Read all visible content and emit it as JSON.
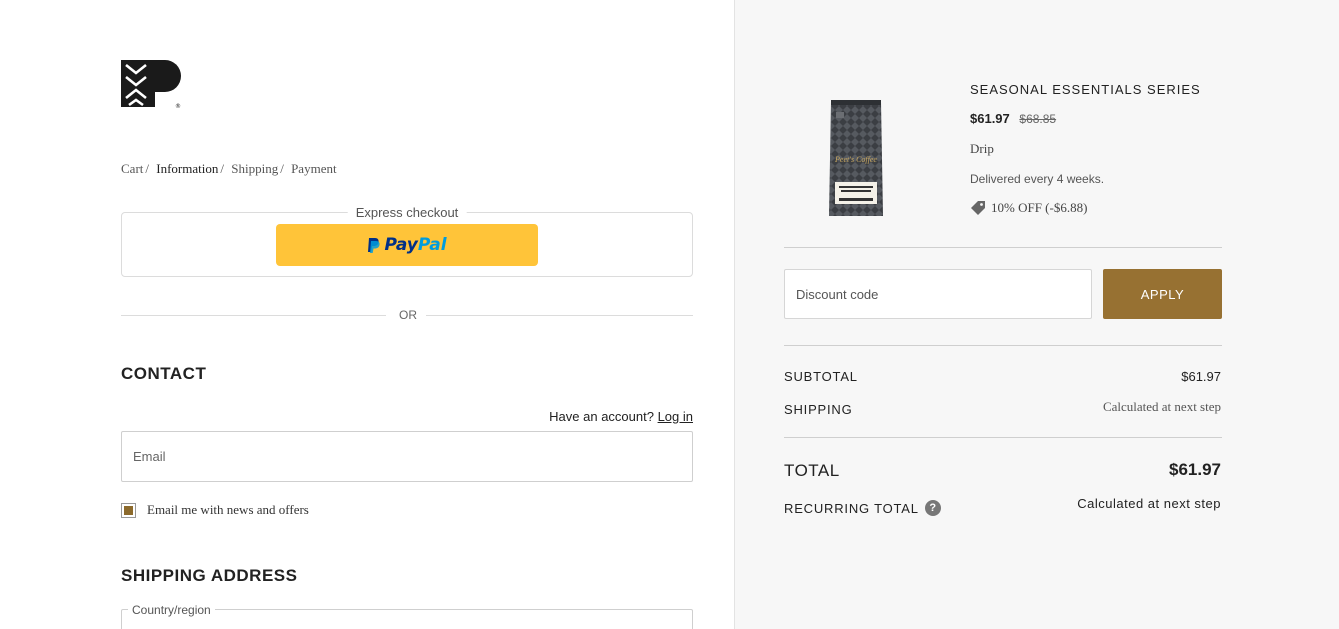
{
  "logo": {
    "icon": "peets-p-logo-icon"
  },
  "breadcrumb": {
    "items": [
      "Cart",
      "Information",
      "Shipping",
      "Payment"
    ],
    "separator": "/"
  },
  "express": {
    "label": "Express checkout",
    "paypal_pay": "Pay",
    "paypal_pal": "Pal",
    "paypal_color": "#ffc439"
  },
  "divider_or": "OR",
  "contact": {
    "heading": "CONTACT",
    "account_prompt": "Have an account?",
    "login_link": "Log in",
    "email_placeholder": "Email",
    "news_label": "Email me with news and offers",
    "news_checked": true
  },
  "shipping": {
    "heading": "SHIPPING ADDRESS",
    "country_label": "Country/region"
  },
  "product": {
    "title": "SEASONAL ESSENTIALS SERIES",
    "price": "$61.97",
    "original_price": "$68.85",
    "variant": "Drip",
    "delivery": "Delivered every 4 weeks.",
    "discount": "10% OFF (-$6.88)",
    "image_icon": "coffee-bag-icon"
  },
  "discount_code": {
    "placeholder": "Discount code",
    "apply_label": "APPLY",
    "button_color": "#977132"
  },
  "summary": {
    "subtotal_label": "SUBTOTAL",
    "subtotal_value": "$61.97",
    "shipping_label": "SHIPPING",
    "shipping_value": "Calculated at next step",
    "total_label": "TOTAL",
    "total_value": "$61.97",
    "recurring_label": "RECURRING TOTAL",
    "recurring_value": "Calculated at next step"
  }
}
